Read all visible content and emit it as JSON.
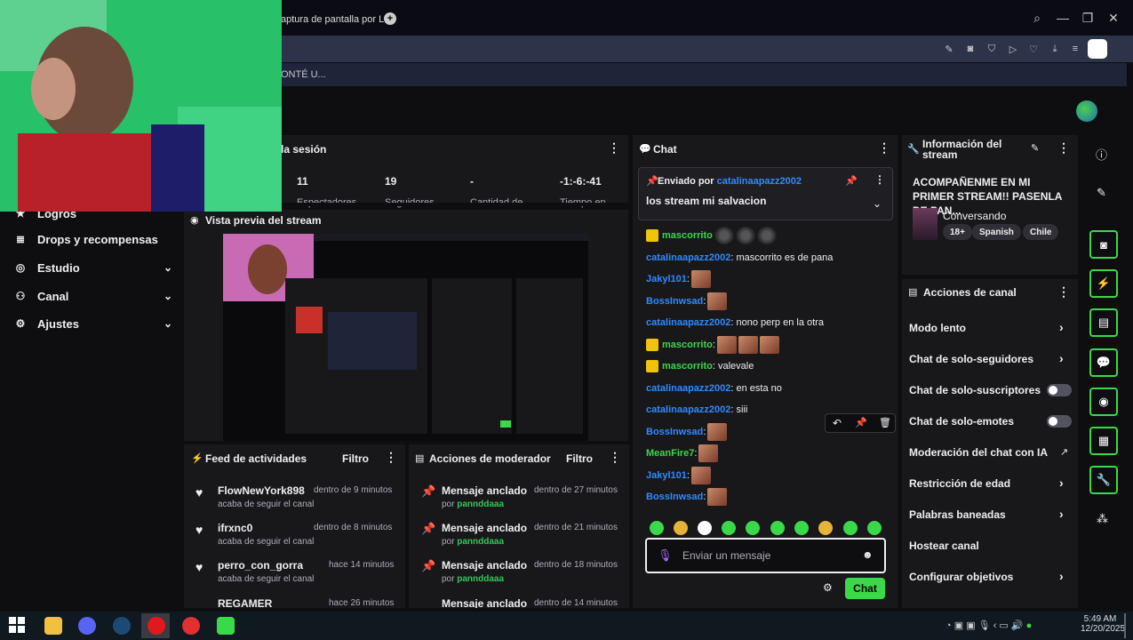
{
  "browser": {
    "tab_title": "aptura de pantalla por Li",
    "notification": "ONTÉ U..."
  },
  "nav": {
    "items": [
      {
        "label": "Logros"
      },
      {
        "label": "Drops y recompensas"
      },
      {
        "label": "Estudio"
      },
      {
        "label": "Canal"
      },
      {
        "label": "Ajustes"
      }
    ]
  },
  "session": {
    "title": "la sesión",
    "stats": [
      {
        "value": "11",
        "label": "Espectadores"
      },
      {
        "value": "19",
        "label": "Seguidores"
      },
      {
        "value": "-",
        "label": "Cantidad de"
      },
      {
        "value": "-1:-6:-41",
        "label": "Tiempo en"
      }
    ]
  },
  "preview": {
    "title": "Vista previa del stream"
  },
  "feed": {
    "title": "Feed de actividades",
    "filter": "Filtro",
    "items": [
      {
        "name": "FlowNewYork898",
        "time": "dentro de 9 minutos",
        "action": "acaba de seguir el canal"
      },
      {
        "name": "ifrxnc0",
        "time": "dentro de 8 minutos",
        "action": "acaba de seguir el canal"
      },
      {
        "name": "perro_con_gorra",
        "time": "hace 14 minutos",
        "action": "acaba de seguir el canal"
      },
      {
        "name": "REGAMER",
        "time": "hace 26 minutos",
        "action": ""
      }
    ]
  },
  "modactions": {
    "title": "Acciones de moderador",
    "filter": "Filtro",
    "items": [
      {
        "label": "Mensaje anclado",
        "time": "dentro de 27 minutos",
        "by": "por",
        "user": "pannddaaa"
      },
      {
        "label": "Mensaje anclado",
        "time": "dentro de 21 minutos",
        "by": "por",
        "user": "pannddaaa"
      },
      {
        "label": "Mensaje anclado",
        "time": "dentro de 18 minutos",
        "by": "por",
        "user": "pannddaaa"
      },
      {
        "label": "Mensaje anclado",
        "time": "dentro de 14 minutos",
        "by": "",
        "user": ""
      }
    ]
  },
  "chat": {
    "title": "Chat",
    "pinned": {
      "prefix": "Enviado por",
      "user": "catalinaapazz2002",
      "message": "los stream mi salvacion"
    },
    "messages": [
      {
        "user": "mascorrito",
        "text": "",
        "badge": true,
        "color": "#3ad94a",
        "emotes": 3,
        "dark": true
      },
      {
        "user": "catalinaapazz2002",
        "text": ": mascorrito es de pana",
        "badge": false,
        "color": "#2e8bff",
        "emotes": 0
      },
      {
        "user": "Jakyl101",
        "text": ":",
        "badge": false,
        "color": "#2e8bff",
        "emotes": 1
      },
      {
        "user": "BossInwsad",
        "text": ":",
        "badge": false,
        "color": "#2e8bff",
        "emotes": 1
      },
      {
        "user": "catalinaapazz2002",
        "text": ": nono perp en la otra",
        "badge": false,
        "color": "#2e8bff",
        "emotes": 0
      },
      {
        "user": "mascorrito",
        "text": ":",
        "badge": true,
        "color": "#3ad94a",
        "emotes": 3
      },
      {
        "user": "mascorrito",
        "text": ": valevale",
        "badge": true,
        "color": "#3ad94a",
        "emotes": 0
      },
      {
        "user": "catalinaapazz2002",
        "text": ": en esta no",
        "badge": false,
        "color": "#2e8bff",
        "emotes": 0
      },
      {
        "user": "catalinaapazz2002",
        "text": ": siii",
        "badge": false,
        "color": "#2e8bff",
        "emotes": 0
      },
      {
        "user": "BossInwsad",
        "text": ":",
        "badge": false,
        "color": "#2e8bff",
        "emotes": 1
      },
      {
        "user": "MeanFire7",
        "text": ":",
        "badge": false,
        "color": "#3ad94a",
        "emotes": 1
      },
      {
        "user": "Jakyl101",
        "text": ":",
        "badge": false,
        "color": "#2e8bff",
        "emotes": 1
      },
      {
        "user": "BossInwsad",
        "text": ":",
        "badge": false,
        "color": "#2e8bff",
        "emotes": 1
      }
    ],
    "input_placeholder": "Enviar un mensaje",
    "send_label": "Chat"
  },
  "info": {
    "title": "Información del stream",
    "stream_title": "ACOMPAÑENME EN MI PRIMER STREAM!! PASENLA DE PAN...",
    "category": "Conversando",
    "tags": [
      "18+",
      "Spanish",
      "Chile"
    ]
  },
  "actions": {
    "title": "Acciones de canal",
    "items": [
      {
        "label": "Modo lento",
        "control": "chevron"
      },
      {
        "label": "Chat de solo-seguidores",
        "control": "chevron"
      },
      {
        "label": "Chat de solo-suscriptores",
        "control": "toggle"
      },
      {
        "label": "Chat de solo-emotes",
        "control": "toggle"
      },
      {
        "label": "Moderación del chat con IA",
        "control": "external"
      },
      {
        "label": "Restricción de edad",
        "control": "chevron"
      },
      {
        "label": "Palabras baneadas",
        "control": "chevron"
      },
      {
        "label": "Hostear canal",
        "control": "none"
      },
      {
        "label": "Configurar objetivos",
        "control": "chevron"
      }
    ]
  },
  "taskbar": {
    "time": "5:49 AM",
    "date": "12/20/2025"
  }
}
